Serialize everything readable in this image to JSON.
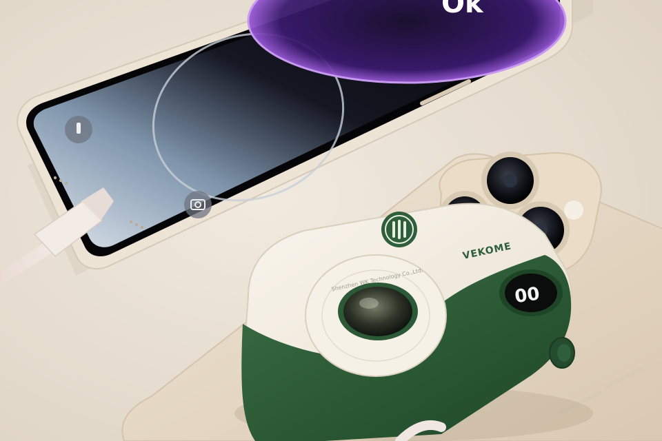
{
  "scene": {
    "background": "#e9e1d6",
    "phone_front": {
      "frame_color": "#eee4d6",
      "screen_wallpaper_text": "Ok",
      "lockscreen_icons": [
        "flashlight-icon",
        "camera-icon"
      ]
    },
    "phone_back": {
      "body_color": "#e6d8c3",
      "camera_lenses": 3
    },
    "cable": {
      "color": "#efe4e0"
    },
    "power_bank": {
      "brand": "VEKOME",
      "display_value": "00",
      "ring_text": "Shenzhen WK Technology Co.,Ltd.",
      "colors": {
        "cream": "#f4efe5",
        "green": "#2f5e3a",
        "dark_green": "#224a2c"
      }
    }
  }
}
